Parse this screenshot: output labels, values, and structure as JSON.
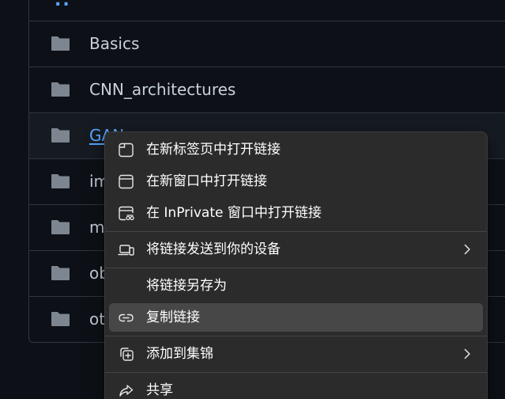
{
  "file_list": {
    "parent_link": "..",
    "folders": [
      {
        "name": "Basics"
      },
      {
        "name": "CNN_architectures"
      },
      {
        "name": "GAN"
      },
      {
        "name": "im"
      },
      {
        "name": "m"
      },
      {
        "name": "ob"
      },
      {
        "name": "ot"
      }
    ]
  },
  "context_menu": {
    "items": [
      {
        "label": "在新标签页中打开链接",
        "icon": "new-tab-icon"
      },
      {
        "label": "在新窗口中打开链接",
        "icon": "new-window-icon"
      },
      {
        "label": "在 InPrivate 窗口中打开链接",
        "icon": "inprivate-window-icon"
      },
      {
        "label": "将链接发送到你的设备",
        "icon": "send-to-device-icon",
        "submenu": true
      },
      {
        "label": "将链接另存为",
        "icon": ""
      },
      {
        "label": "复制链接",
        "icon": "link-icon",
        "highlighted": true
      },
      {
        "label": "添加到集锦",
        "icon": "collections-icon",
        "submenu": true
      },
      {
        "label": "共享",
        "icon": "share-icon"
      }
    ]
  },
  "colors": {
    "page_bg": "#0d1117",
    "border": "#30363d",
    "folder": "#7d8590",
    "link": "#58a6ff",
    "menu_bg": "#2b2b2b",
    "menu_highlight": "#474747"
  }
}
